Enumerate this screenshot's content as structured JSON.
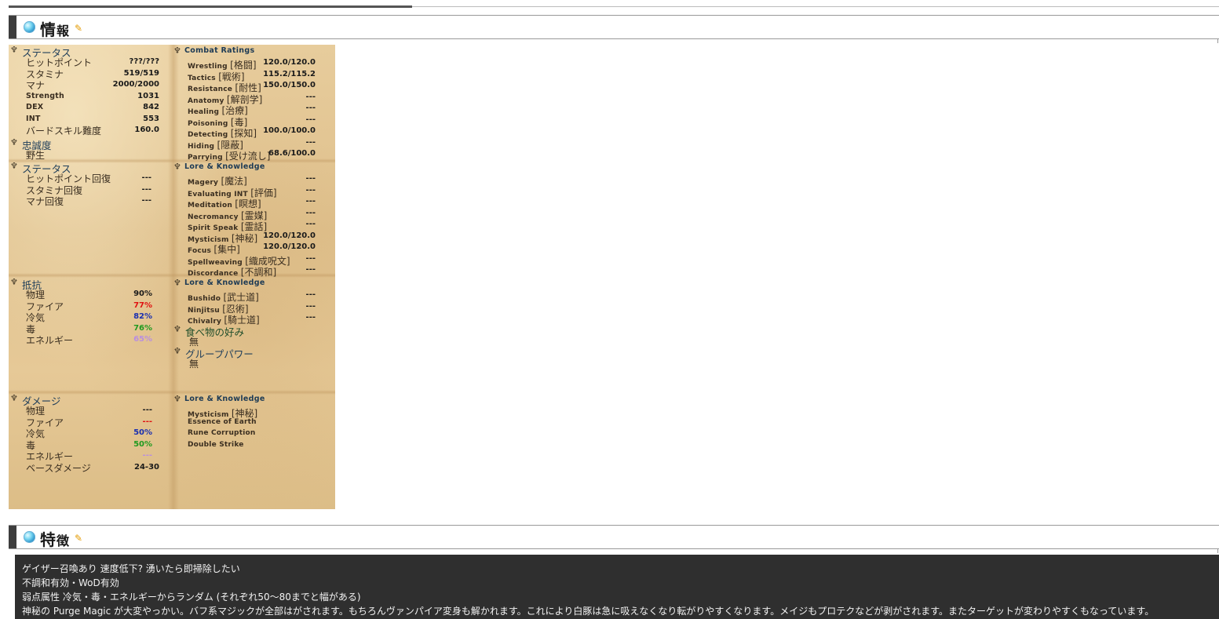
{
  "section1": {
    "title_big": "情",
    "title_small": "報",
    "edit_icon": "pencil-icon"
  },
  "section2": {
    "title_big": "特",
    "title_small": "徴",
    "edit_icon": "pencil-icon"
  },
  "status": {
    "header": "ステータス",
    "rows": [
      {
        "label": "ヒットポイント",
        "value": "???/???"
      },
      {
        "label": "スタミナ",
        "value": "519/519"
      },
      {
        "label": "マナ",
        "value": "2000/2000"
      },
      {
        "label": "Strength",
        "value": "1031"
      },
      {
        "label": "DEX",
        "value": "842"
      },
      {
        "label": "INT",
        "value": "553"
      },
      {
        "label": "バードスキル難度",
        "value": "160.0"
      }
    ]
  },
  "loyalty": {
    "header": "忠誠度",
    "value": "野生"
  },
  "regen": {
    "header": "ステータス",
    "rows": [
      {
        "label": "ヒットポイント回復",
        "value": "---"
      },
      {
        "label": "スタミナ回復",
        "value": "---"
      },
      {
        "label": "マナ回復",
        "value": "---"
      }
    ]
  },
  "resist": {
    "header": "抵抗",
    "rows": [
      {
        "label": "物理",
        "value": "90%",
        "color": "#1a1a1a"
      },
      {
        "label": "ファイア",
        "value": "77%",
        "color": "#e01010"
      },
      {
        "label": "冷気",
        "value": "82%",
        "color": "#1a2fb0"
      },
      {
        "label": "毒",
        "value": "76%",
        "color": "#1f9a1f"
      },
      {
        "label": "エネルギー",
        "value": "65%",
        "color": "#b98ee0"
      }
    ]
  },
  "damage": {
    "header": "ダメージ",
    "rows": [
      {
        "label": "物理",
        "value": "---",
        "color": "#1a1a1a"
      },
      {
        "label": "ファイア",
        "value": "---",
        "color": "#e01010"
      },
      {
        "label": "冷気",
        "value": "50%",
        "color": "#1a2fb0"
      },
      {
        "label": "毒",
        "value": "50%",
        "color": "#1f9a1f"
      },
      {
        "label": "エネルギー",
        "value": "---",
        "color": "#b98ee0"
      },
      {
        "label": "ベースダメージ",
        "value": "24-30",
        "color": "#1a1a1a"
      }
    ]
  },
  "combat": {
    "header": "Combat Ratings",
    "rows": [
      {
        "en": "Wrestling",
        "jp": "[格闘]",
        "value": "120.0/120.0"
      },
      {
        "en": "Tactics",
        "jp": "[戦術]",
        "value": "115.2/115.2"
      },
      {
        "en": "Resistance",
        "jp": "[耐性]",
        "value": "150.0/150.0"
      },
      {
        "en": "Anatomy",
        "jp": "[解剖学]",
        "value": "---"
      },
      {
        "en": "Healing",
        "jp": "[治療]",
        "value": "---"
      },
      {
        "en": "Poisoning",
        "jp": "[毒]",
        "value": "---"
      },
      {
        "en": "Detecting",
        "jp": "[探知]",
        "value": "100.0/100.0"
      },
      {
        "en": "Hiding",
        "jp": "[隠蔽]",
        "value": "---"
      },
      {
        "en": "Parrying",
        "jp": "[受け流し]",
        "value": "68.6/100.0"
      }
    ]
  },
  "lore1": {
    "header": "Lore & Knowledge",
    "rows": [
      {
        "en": "Magery",
        "jp": "[魔法]",
        "value": "---"
      },
      {
        "en": "Evaluating INT",
        "jp": "[評価]",
        "value": "---"
      },
      {
        "en": "Meditation",
        "jp": "[瞑想]",
        "value": "---"
      },
      {
        "en": "Necromancy",
        "jp": "[霊媒]",
        "value": "---"
      },
      {
        "en": "Spirit Speak",
        "jp": "[霊話]",
        "value": "---"
      },
      {
        "en": "Mysticism",
        "jp": "[神秘]",
        "value": "120.0/120.0"
      },
      {
        "en": "Focus",
        "jp": "[集中]",
        "value": "120.0/120.0"
      },
      {
        "en": "Spellweaving",
        "jp": "[織成呪文]",
        "value": "---"
      },
      {
        "en": "Discordance",
        "jp": "[不調和]",
        "value": "---"
      }
    ]
  },
  "lore2": {
    "header": "Lore & Knowledge",
    "rows": [
      {
        "en": "Bushido",
        "jp": "[武士道]",
        "value": "---"
      },
      {
        "en": "Ninjitsu",
        "jp": "[忍術]",
        "value": "---"
      },
      {
        "en": "Chivalry",
        "jp": "[騎士道]",
        "value": "---"
      }
    ]
  },
  "food": {
    "header": "食べ物の好み",
    "value": "無"
  },
  "group": {
    "header": "グループパワー",
    "value": "無"
  },
  "lore3": {
    "header": "Lore & Knowledge",
    "rows": [
      {
        "en": "Mysticism",
        "jp": "[神秘]"
      },
      {
        "en": "Essence of Earth",
        "jp": ""
      },
      {
        "en": "Rune Corruption",
        "jp": ""
      },
      {
        "en": "Double Strike",
        "jp": ""
      }
    ]
  },
  "description": [
    "ゲイザー召喚あり 速度低下? 湧いたら即掃除したい",
    "不調和有効・WoD有効",
    "弱点属性 冷気・毒・エネルギーからランダム (それぞれ50〜80までと幅がある)",
    "神秘の Purge Magic が大変やっかい。バフ系マジックが全部はがされます。もちろんヴァンパイア変身も解かれます。これにより白豚は急に吸えなくなり転がりやすくなります。メイジもプロテクなどが剥がされます。またターゲットが変わりやすくもなっています。"
  ]
}
